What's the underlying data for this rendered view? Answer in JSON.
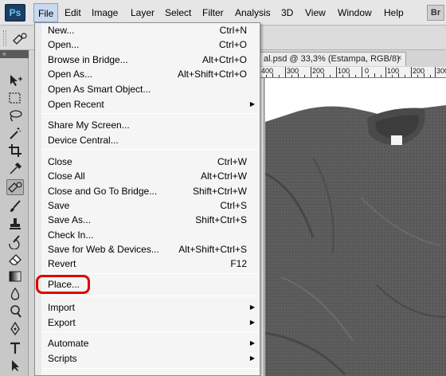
{
  "app": {
    "logo": "Ps",
    "bridge_badge": "Br"
  },
  "menubar": {
    "items": [
      "File",
      "Edit",
      "Image",
      "Layer",
      "Select",
      "Filter",
      "Analysis",
      "3D",
      "View",
      "Window",
      "Help"
    ],
    "active": "File"
  },
  "document": {
    "tab_title": "al.psd @ 33,3% (Estampa, RGB/8)",
    "tab_close": "×",
    "ruler_labels": [
      "400",
      "300",
      "200",
      "100",
      "0",
      "100",
      "200",
      "300"
    ]
  },
  "file_menu": {
    "items": [
      {
        "label": "New...",
        "shortcut": "Ctrl+N"
      },
      {
        "label": "Open...",
        "shortcut": "Ctrl+O"
      },
      {
        "label": "Browse in Bridge...",
        "shortcut": "Alt+Ctrl+O"
      },
      {
        "label": "Open As...",
        "shortcut": "Alt+Shift+Ctrl+O"
      },
      {
        "label": "Open As Smart Object...",
        "shortcut": ""
      },
      {
        "label": "Open Recent",
        "shortcut": "",
        "submenu": true
      },
      {
        "label": "Share My Screen...",
        "shortcut": ""
      },
      {
        "label": "Device Central...",
        "shortcut": ""
      },
      {
        "label": "Close",
        "shortcut": "Ctrl+W"
      },
      {
        "label": "Close All",
        "shortcut": "Alt+Ctrl+W"
      },
      {
        "label": "Close and Go To Bridge...",
        "shortcut": "Shift+Ctrl+W"
      },
      {
        "label": "Save",
        "shortcut": "Ctrl+S"
      },
      {
        "label": "Save As...",
        "shortcut": "Shift+Ctrl+S"
      },
      {
        "label": "Check In...",
        "shortcut": ""
      },
      {
        "label": "Save for Web & Devices...",
        "shortcut": "Alt+Shift+Ctrl+S"
      },
      {
        "label": "Revert",
        "shortcut": "F12"
      },
      {
        "label": "Place...",
        "shortcut": "",
        "highlighted": true
      },
      {
        "label": "Import",
        "shortcut": "",
        "submenu": true
      },
      {
        "label": "Export",
        "shortcut": "",
        "submenu": true
      },
      {
        "label": "Automate",
        "shortcut": "",
        "submenu": true
      },
      {
        "label": "Scripts",
        "shortcut": "",
        "submenu": true
      }
    ]
  },
  "colors": {
    "highlight": "#e00000",
    "menu_active": "#c9daf0",
    "shirt": "#5b5b5b"
  },
  "icons": {
    "submenu_arrow": "▶",
    "tools": [
      "move-icon",
      "marquee-icon",
      "lasso-icon",
      "magic-wand-icon",
      "crop-icon",
      "eyedropper-icon",
      "spot-healing-icon",
      "brush-icon",
      "clone-stamp-icon",
      "history-brush-icon",
      "eraser-icon",
      "gradient-icon",
      "blur-icon",
      "dodge-icon",
      "pen-icon",
      "type-icon",
      "path-selection-icon"
    ]
  }
}
